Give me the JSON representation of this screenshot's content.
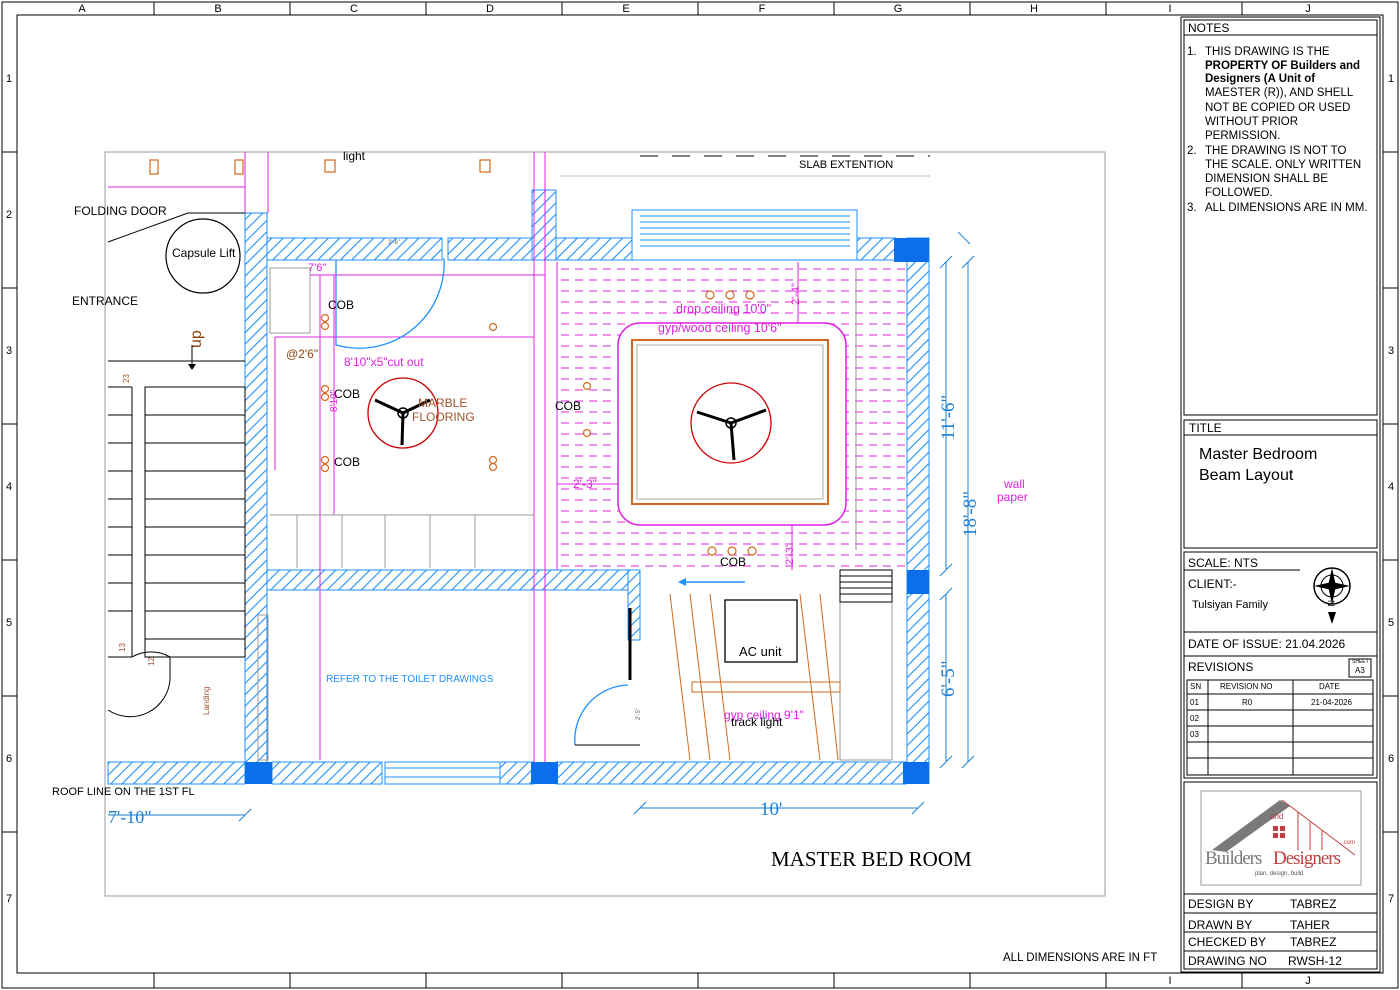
{
  "sheet": {
    "col_labels": [
      "A",
      "B",
      "C",
      "D",
      "E",
      "F",
      "G",
      "H",
      "I",
      "J"
    ],
    "row_labels": [
      "1",
      "2",
      "3",
      "4",
      "5",
      "6",
      "7"
    ]
  },
  "notes": {
    "heading": "NOTES",
    "items": [
      {
        "num": "1.",
        "lines": [
          "THIS DRAWING IS THE",
          "PROPERTY OF Builders and",
          "Designers (A Unit of",
          "MAESTER (R)),  AND SHELL",
          "NOT BE COPIED OR USED",
          "WITHOUT PRIOR",
          "PERMISSION."
        ]
      },
      {
        "num": "2.",
        "lines": [
          "THE DRAWING  IS NOT TO",
          "THE SCALE. ONLY WRITTEN",
          "DIMENSION SHALL BE",
          "FOLLOWED."
        ]
      },
      {
        "num": "3.",
        "lines": [
          "ALL DIMENSIONS ARE IN MM."
        ]
      }
    ]
  },
  "title_block": {
    "title_label": "TITLE",
    "title_line1": "Master Bedroom",
    "title_line2": "Beam Layout",
    "scale": "SCALE: NTS",
    "client_label": "CLIENT:-",
    "client_name": "Tulsiyan Family",
    "north": "N",
    "date_of_issue": "DATE OF ISSUE:  21.04.2026",
    "revisions_label": "REVISIONS",
    "sheet_label": "SHEET",
    "sheet_value": "A3",
    "rev_headers": [
      "SN",
      "REVISION NO",
      "DATE"
    ],
    "rev_rows": [
      [
        "01",
        "R0",
        "21-04-2026"
      ],
      [
        "02",
        "",
        ""
      ],
      [
        "03",
        "",
        ""
      ],
      [
        "",
        "",
        ""
      ]
    ],
    "logo_and": "and",
    "logo_builders": "Builders",
    "logo_designers": "Designers",
    "logo_com": ".com",
    "logo_tagline": "plan, design, build",
    "design_by_label": "DESIGN BY",
    "design_by": "TABREZ",
    "drawn_by_label": "DRAWN BY",
    "drawn_by": "TAHER",
    "checked_by_label": "CHECKED BY",
    "checked_by": "TABREZ",
    "drawing_no_label": "DRAWING NO",
    "drawing_no": "RWSH-12"
  },
  "drawing": {
    "folding_door": "FOLDING DOOR",
    "capsule_lift": "Capsule Lift",
    "entrance": "ENTRANCE",
    "up": "up",
    "light": "light",
    "slab_extention": "SLAB EXTENTION",
    "cob": "COB",
    "dim_7_6": "7'6\"",
    "at_2_6": "@2'6\"",
    "cut_out": "8'10\"x5\"cut out",
    "dim_8_10": "8'10\"",
    "marble": "MARBLE",
    "flooring": "FLOORING",
    "drop_ceiling": "drop ceiling 10'0\"",
    "gyp_wood": "gyp/wood ceiling 10'6\"",
    "dim_2_4": "2'-4\"",
    "dim_2_3a": "2'-3\"",
    "dim_2_3b": "2'-3\"",
    "dim_11_6": "11'-6\"",
    "dim_18_8": "18'-8\"",
    "dim_6_5": "6'-5\"",
    "wall": "wall",
    "paper": "paper",
    "ac_unit": "AC unit",
    "toilet": "REFER TO THE TOILET DRAWINGS",
    "gyp_ceiling": "gyp ceiling 9'1\"",
    "track_light": "track light",
    "roof_line": "ROOF LINE ON THE 1ST FL",
    "dim_7_10": "7'-10\"",
    "dim_10": "10'",
    "master_bed": "MASTER BED ROOM",
    "all_dims_ft": "ALL DIMENSIONS ARE IN  FT",
    "landing": "Landing",
    "step_23": "23",
    "step_13": "13",
    "step_12": "12",
    "small_2_5": "2'-5\"",
    "small_3_6": "3'-6\""
  },
  "colors": {
    "wall_blue": "#1e90ff",
    "magenta": "#e020e0",
    "orange": "#d2691e",
    "red": "#cc0000",
    "dim_blue": "#1a7fd4",
    "column_fill": "#0a6fe8"
  }
}
